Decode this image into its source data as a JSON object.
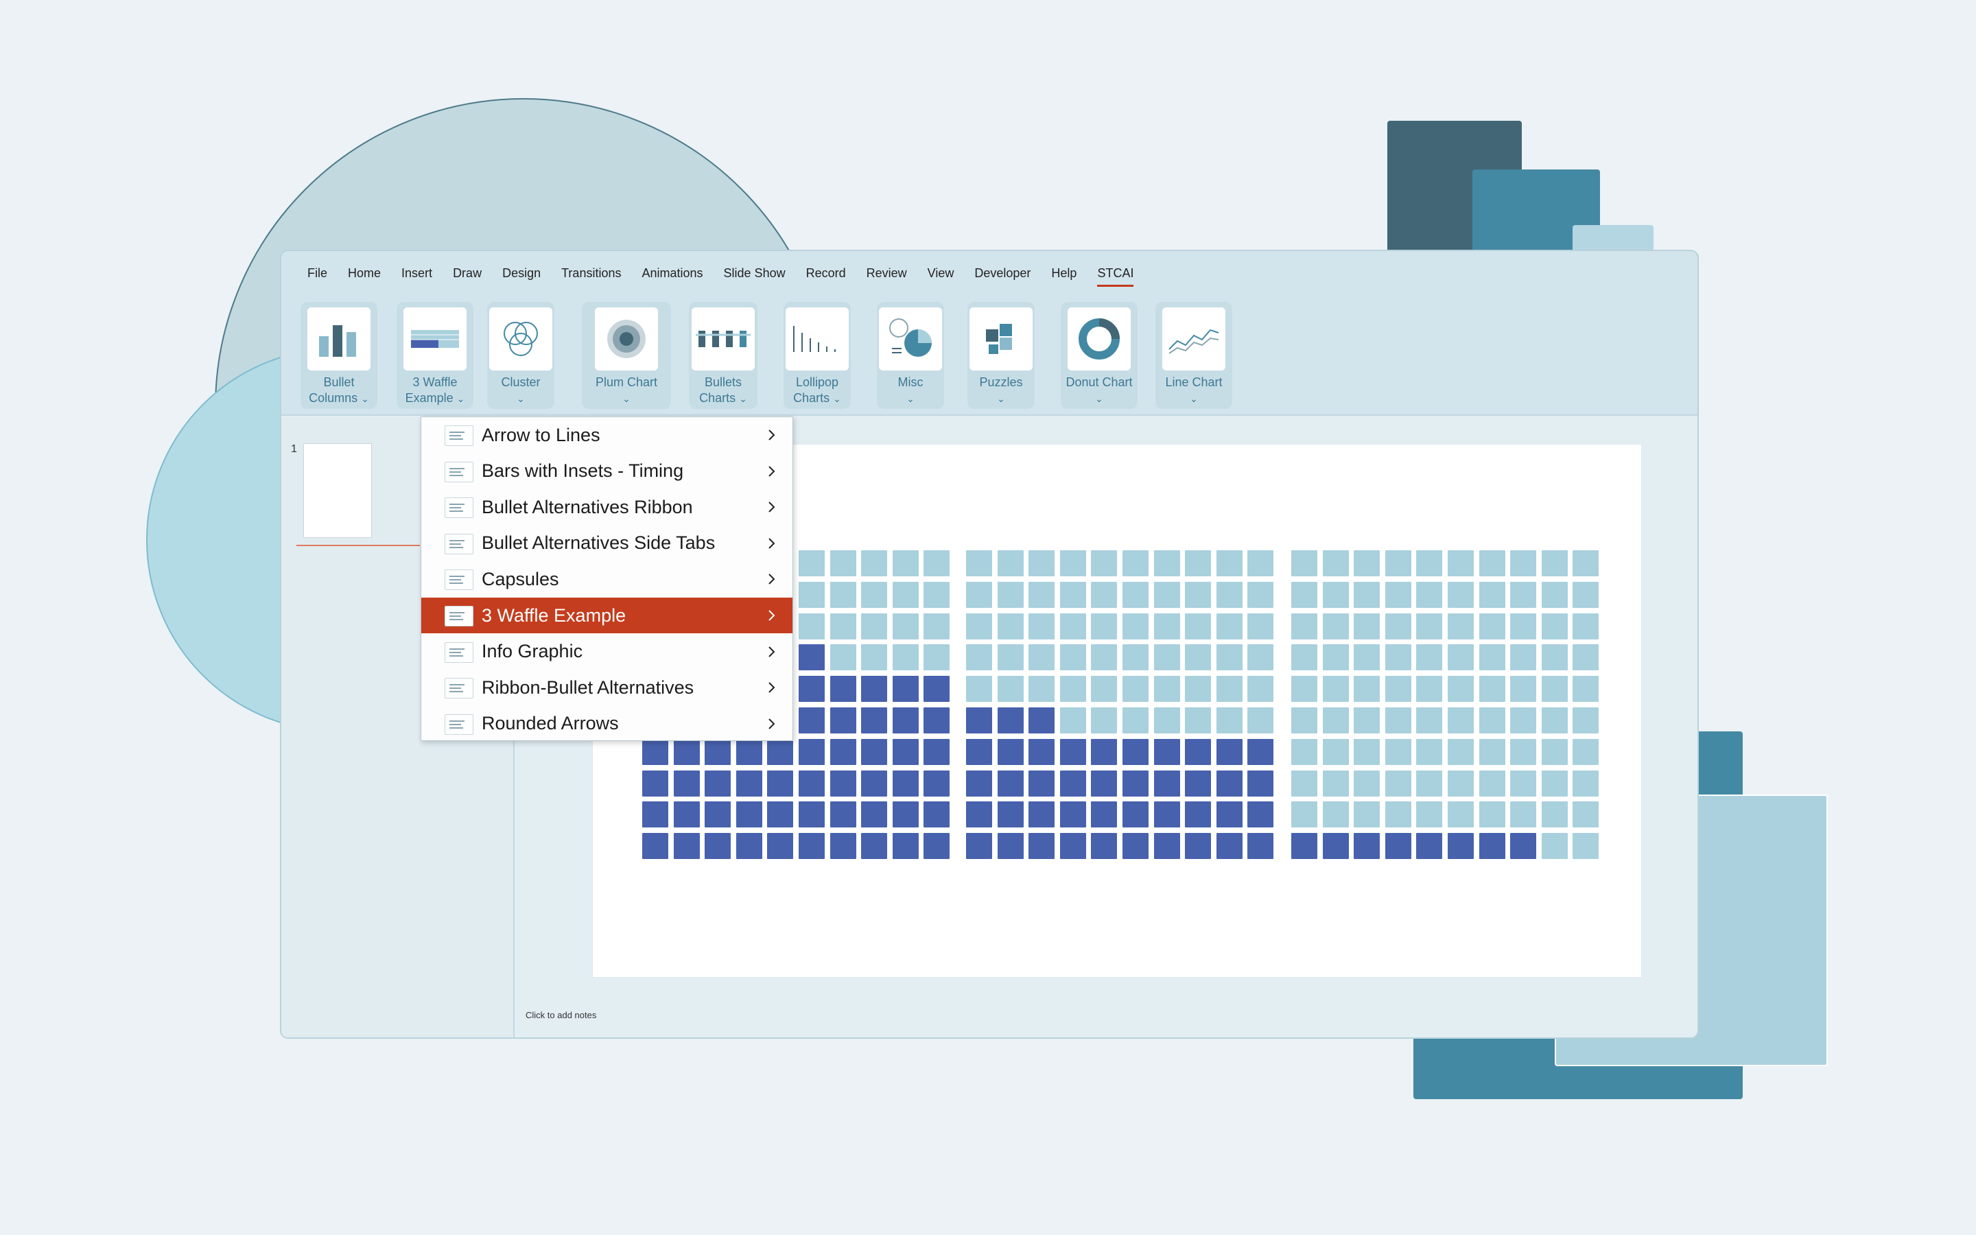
{
  "menubar": {
    "items": [
      "File",
      "Home",
      "Insert",
      "Draw",
      "Design",
      "Transitions",
      "Animations",
      "Slide Show",
      "Record",
      "Review",
      "View",
      "Developer",
      "Help",
      "STCAI"
    ],
    "active": "STCAI"
  },
  "ribbon": {
    "buttons": [
      {
        "line1": "Bullet",
        "line2": "Columns",
        "caret": "⌄",
        "icon": "bullet-columns-icon"
      },
      {
        "line1": "3 Waffle",
        "line2": "Example",
        "caret": "⌄",
        "icon": "waffle-icon"
      },
      {
        "line1": "Cluster",
        "line2": "",
        "caret": "⌄",
        "icon": "cluster-icon"
      },
      {
        "line1": "Plum Chart",
        "line2": "",
        "caret": "⌄",
        "icon": "plum-chart-icon"
      },
      {
        "line1": "Bullets",
        "line2": "Charts",
        "caret": "⌄",
        "icon": "bullets-charts-icon"
      },
      {
        "line1": "Lollipop",
        "line2": "Charts",
        "caret": "⌄",
        "icon": "lollipop-charts-icon"
      },
      {
        "line1": "Misc",
        "line2": "",
        "caret": "⌄",
        "icon": "misc-icon"
      },
      {
        "line1": "Puzzles",
        "line2": "",
        "caret": "⌄",
        "icon": "puzzles-icon"
      },
      {
        "line1": "Donut Chart",
        "line2": "",
        "caret": "⌄",
        "icon": "donut-chart-icon"
      },
      {
        "line1": "Line Chart",
        "line2": "",
        "caret": "⌄",
        "icon": "line-chart-icon"
      }
    ]
  },
  "thumbnails": {
    "slide_number": "1"
  },
  "notes": {
    "placeholder": "Click to add notes"
  },
  "dropdown": {
    "items": [
      {
        "label": "Arrow to Lines",
        "selected": false
      },
      {
        "label": "Bars with Insets - Timing",
        "selected": false
      },
      {
        "label": "Bullet Alternatives Ribbon",
        "selected": false
      },
      {
        "label": "Bullet Alternatives Side Tabs",
        "selected": false
      },
      {
        "label": "Capsules",
        "selected": false
      },
      {
        "label": "3 Waffle Example",
        "selected": true
      },
      {
        "label": "Info Graphic",
        "selected": false
      },
      {
        "label": "Ribbon-Bullet Alternatives",
        "selected": false
      },
      {
        "label": "Rounded Arrows",
        "selected": false
      }
    ]
  },
  "colors": {
    "filled": "#4761ad",
    "empty": "#a9d0dd",
    "accent": "#c43d1e"
  },
  "waffles": [
    {
      "filled_cells": 66,
      "total_cells": 100
    },
    {
      "filled_cells": 43,
      "total_cells": 100
    },
    {
      "filled_cells": 8,
      "total_cells": 100
    }
  ]
}
